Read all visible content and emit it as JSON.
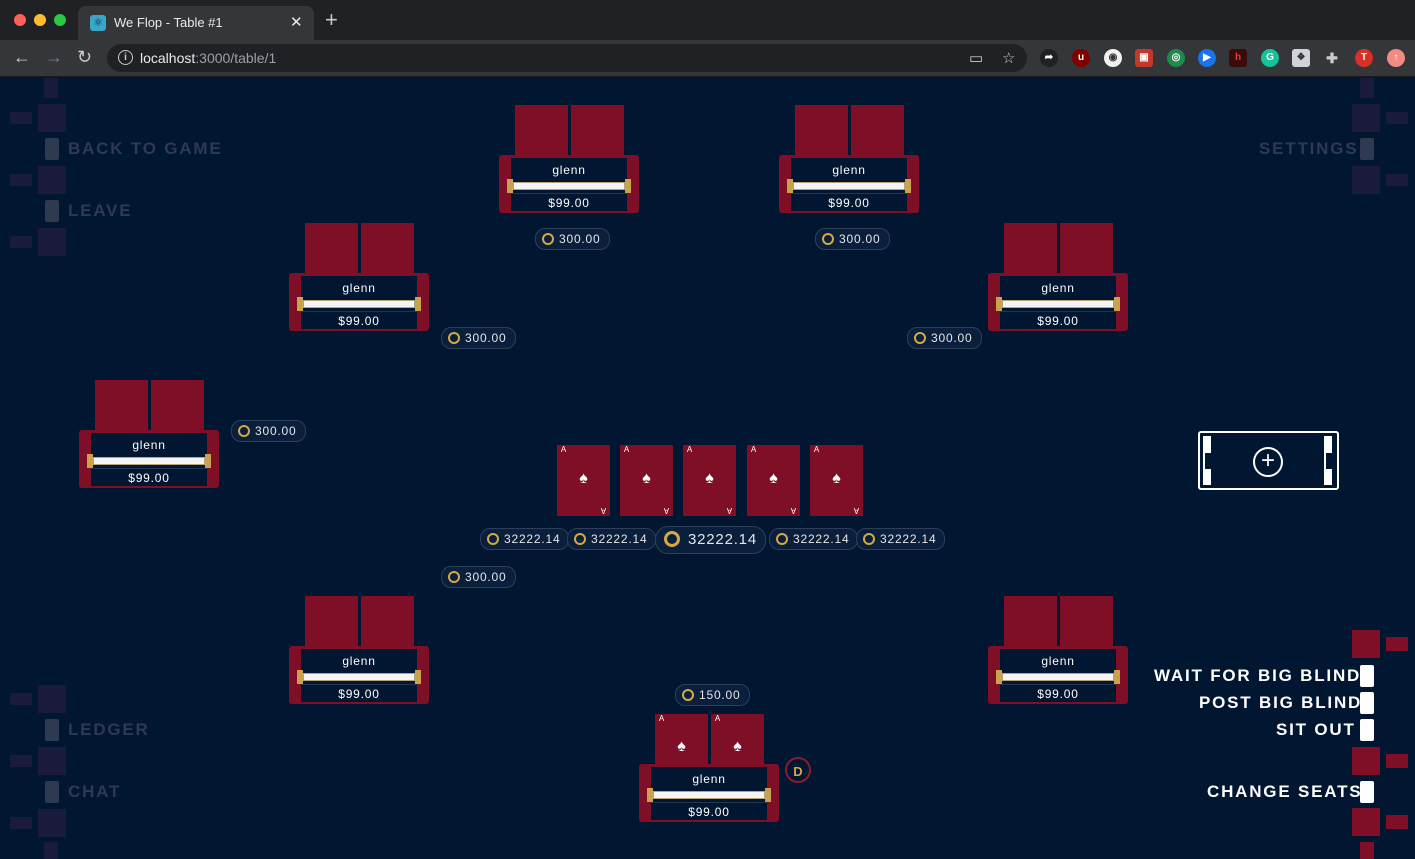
{
  "browser": {
    "tab_title": "We Flop - Table #1",
    "url_host": "localhost",
    "url_path": ":3000/table/1",
    "profile_initial": "T"
  },
  "menu": {
    "back_to_game": "BACK TO GAME",
    "leave": "LEAVE",
    "ledger": "LEDGER",
    "chat": "CHAT",
    "settings": "SETTINGS"
  },
  "options": {
    "wait_for_big_blind": "WAIT FOR BIG BLIND",
    "post_big_blind": "POST BIG BLIND",
    "sit_out": "SIT OUT",
    "change_seats": "CHANGE SEATS"
  },
  "seats": [
    {
      "name": "glenn",
      "stack": "$99.00",
      "bet": "300.00"
    },
    {
      "name": "glenn",
      "stack": "$99.00",
      "bet": "300.00"
    },
    {
      "name": "glenn",
      "stack": "$99.00",
      "bet": "300.00"
    },
    {
      "name": "glenn",
      "stack": "$99.00",
      "bet": "300.00"
    },
    {
      "name": "glenn",
      "stack": "$99.00",
      "bet": "300.00"
    },
    {
      "name": "glenn",
      "stack": "$99.00",
      "bet": "300.00"
    },
    {
      "name": "glenn",
      "stack": "$99.00",
      "bet": ""
    },
    {
      "name": "glenn",
      "stack": "$99.00",
      "bet": "150.00"
    }
  ],
  "pots": {
    "main": "32222.14",
    "side": [
      "32222.14",
      "32222.14",
      "32222.14",
      "32222.14"
    ]
  },
  "board": [
    {
      "rank": "A",
      "suit": "♠"
    },
    {
      "rank": "A",
      "suit": "♠"
    },
    {
      "rank": "A",
      "suit": "♠"
    },
    {
      "rank": "A",
      "suit": "♠"
    },
    {
      "rank": "A",
      "suit": "♠"
    }
  ],
  "hero_cards": [
    {
      "rank": "A",
      "suit": "♠"
    },
    {
      "rank": "A",
      "suit": "♠"
    }
  ],
  "dealer_label": "D",
  "colors": {
    "table_bg": "#011631",
    "seat_red": "#7e0f27",
    "chip_gold": "#d4a847"
  }
}
